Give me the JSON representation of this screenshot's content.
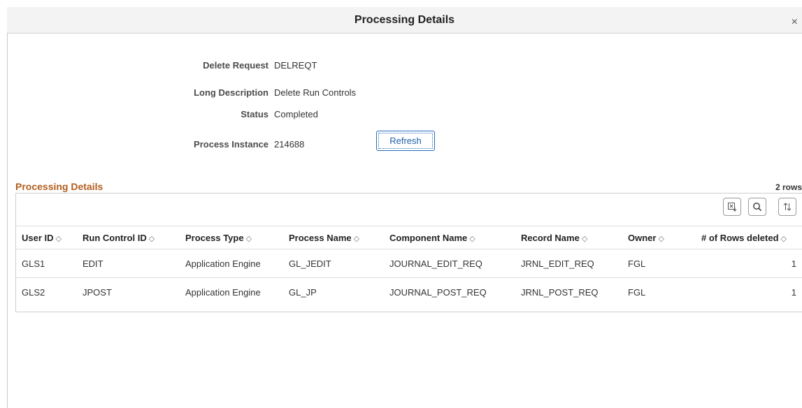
{
  "dialog": {
    "title": "Processing Details",
    "close_glyph": "×"
  },
  "fields": {
    "delete_request": {
      "label": "Delete Request",
      "value": "DELREQT"
    },
    "long_description": {
      "label": "Long Description",
      "value": "Delete Run Controls"
    },
    "status": {
      "label": "Status",
      "value": "Completed"
    },
    "process_instance": {
      "label": "Process Instance",
      "value": "214688"
    }
  },
  "refresh_label": "Refresh",
  "grid": {
    "title": "Processing Details",
    "row_count": "2 rows",
    "toolbar": {
      "export_icon": "export-excel-icon",
      "search_icon": "search-icon",
      "sort_icon": "sort-icon"
    },
    "sort_glyph": "◇",
    "columns": [
      "User ID",
      "Run Control ID",
      "Process Type",
      "Process Name",
      "Component Name",
      "Record Name",
      "Owner",
      "# of Rows deleted"
    ],
    "rows": [
      [
        "GLS1",
        "EDIT",
        "Application Engine",
        "GL_JEDIT",
        "JOURNAL_EDIT_REQ",
        "JRNL_EDIT_REQ",
        "FGL",
        "1"
      ],
      [
        "GLS2",
        "JPOST",
        "Application Engine",
        "GL_JP",
        "JOURNAL_POST_REQ",
        "JRNL_POST_REQ",
        "FGL",
        "1"
      ]
    ]
  },
  "colors": {
    "grid_title": "#b35d1e",
    "button_border": "#2a6bb8",
    "titlebar_bg": "#f3f3f3"
  }
}
